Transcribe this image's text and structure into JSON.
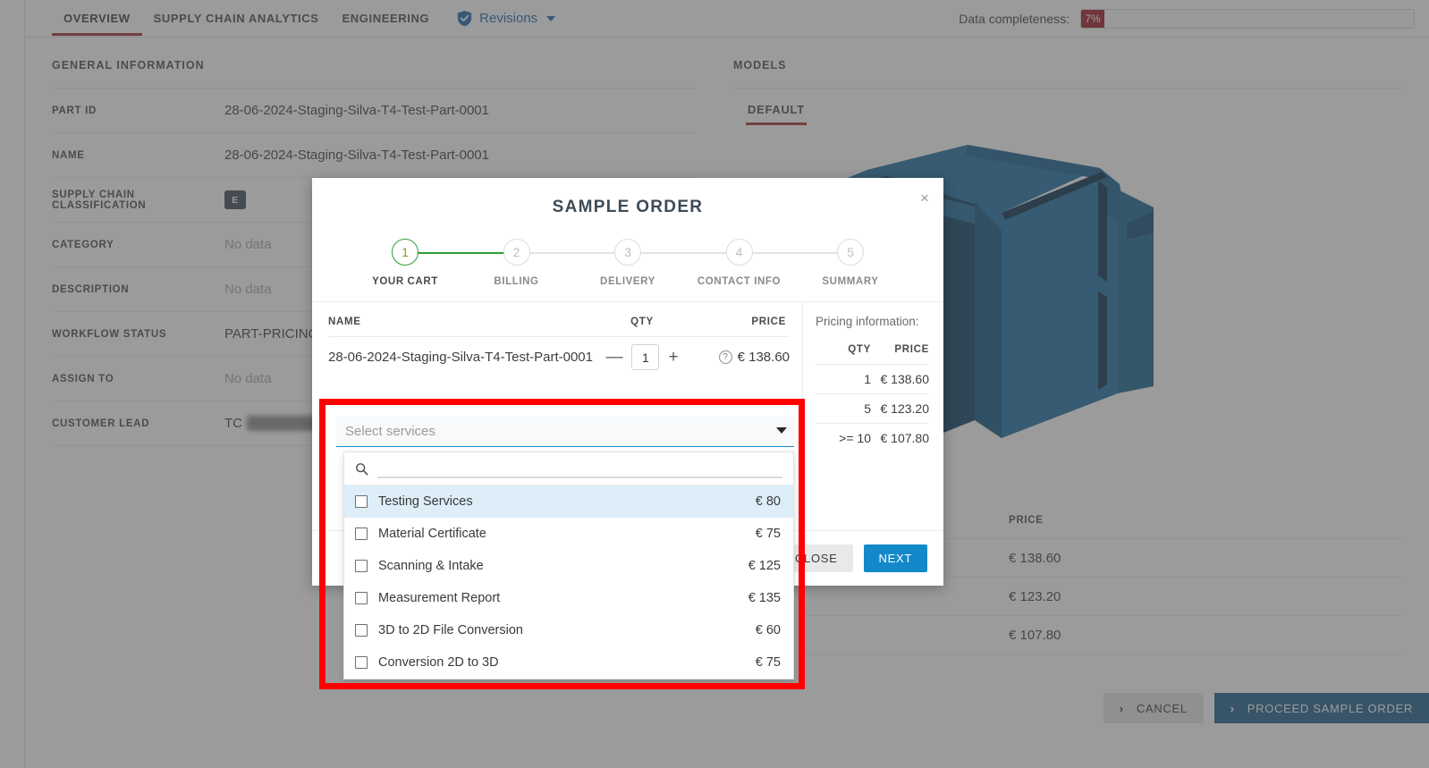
{
  "topbar": {
    "tabs": [
      {
        "label": "OVERVIEW",
        "active": true
      },
      {
        "label": "SUPPLY CHAIN ANALYTICS",
        "active": false
      },
      {
        "label": "ENGINEERING",
        "active": false
      }
    ],
    "revisions_label": "Revisions",
    "completeness_label": "Data completeness:",
    "completeness_value": "7%",
    "accent_red": "#a22f2f",
    "progress_color": "#9e1b28"
  },
  "general": {
    "title": "GENERAL INFORMATION",
    "fields": [
      {
        "label": "PART ID",
        "value": "28-06-2024-Staging-Silva-T4-Test-Part-0001",
        "empty": false
      },
      {
        "label": "NAME",
        "value": "28-06-2024-Staging-Silva-T4-Test-Part-0001",
        "empty": false
      },
      {
        "label": "SUPPLY CHAIN CLASSIFICATION",
        "value": "E",
        "empty": false
      },
      {
        "label": "CATEGORY",
        "value": "No data",
        "empty": true
      },
      {
        "label": "DESCRIPTION",
        "value": "No data",
        "empty": true
      },
      {
        "label": "WORKFLOW STATUS",
        "value": "PART-PRICING-I",
        "empty": false
      },
      {
        "label": "ASSIGN TO",
        "value": "No data",
        "empty": true
      },
      {
        "label": "CUSTOMER LEAD",
        "value": "TC",
        "empty": false
      }
    ]
  },
  "models": {
    "title": "MODELS",
    "tabs": [
      {
        "label": "DEFAULT",
        "active": true
      }
    ],
    "model_color_light": "#1b6ea3",
    "model_color_dark": "#0b3f63"
  },
  "bg_table": {
    "headers": {
      "qty": "",
      "price": "PRICE"
    },
    "rows": [
      {
        "qty": "",
        "price": "€ 138.60"
      },
      {
        "qty": "",
        "price": "€ 123.20"
      },
      {
        "qty": "",
        "price": "€ 107.80"
      }
    ]
  },
  "bottom_actions": {
    "cancel": "CANCEL",
    "proceed": "PROCEED SAMPLE ORDER",
    "chevron": "›"
  },
  "modal": {
    "title": "SAMPLE ORDER",
    "close_icon": "×",
    "steps": [
      {
        "num": "1",
        "label": "YOUR CART",
        "done": true
      },
      {
        "num": "2",
        "label": "BILLING",
        "done": false
      },
      {
        "num": "3",
        "label": "DELIVERY",
        "done": false
      },
      {
        "num": "4",
        "label": "CONTACT INFO",
        "done": false
      },
      {
        "num": "5",
        "label": "SUMMARY",
        "done": false
      }
    ],
    "cart": {
      "headers": {
        "name": "NAME",
        "qty": "QTY",
        "price": "PRICE"
      },
      "row": {
        "name": "28-06-2024-Staging-Silva-T4-Test-Part-0001",
        "minus": "—",
        "qty": "1",
        "plus": "+",
        "help": "?",
        "price": "€ 138.60"
      }
    },
    "pricing": {
      "label": "Pricing information:",
      "headers": {
        "qty": "QTY",
        "price": "PRICE"
      },
      "rows": [
        {
          "qty": "1",
          "price": "€ 138.60"
        },
        {
          "qty": "5",
          "price": "€ 123.20"
        },
        {
          "qty": ">= 10",
          "price": "€ 107.80"
        }
      ]
    },
    "footer": {
      "close": "CLOSE",
      "next": "NEXT",
      "next_color": "#1389ca"
    }
  },
  "services_select": {
    "placeholder": "Select services",
    "search_value": "",
    "items": [
      {
        "name": "Testing Services",
        "price": "€ 80",
        "checked": false,
        "highlighted": true
      },
      {
        "name": "Material Certificate",
        "price": "€ 75",
        "checked": false,
        "highlighted": false
      },
      {
        "name": "Scanning & Intake",
        "price": "€ 125",
        "checked": false,
        "highlighted": false
      },
      {
        "name": "Measurement Report",
        "price": "€ 135",
        "checked": false,
        "highlighted": false
      },
      {
        "name": "3D to 2D File Conversion",
        "price": "€ 60",
        "checked": false,
        "highlighted": false
      },
      {
        "name": "Conversion 2D to 3D",
        "price": "€ 75",
        "checked": false,
        "highlighted": false
      }
    ]
  },
  "annotation": {
    "color": "#ff0000"
  }
}
